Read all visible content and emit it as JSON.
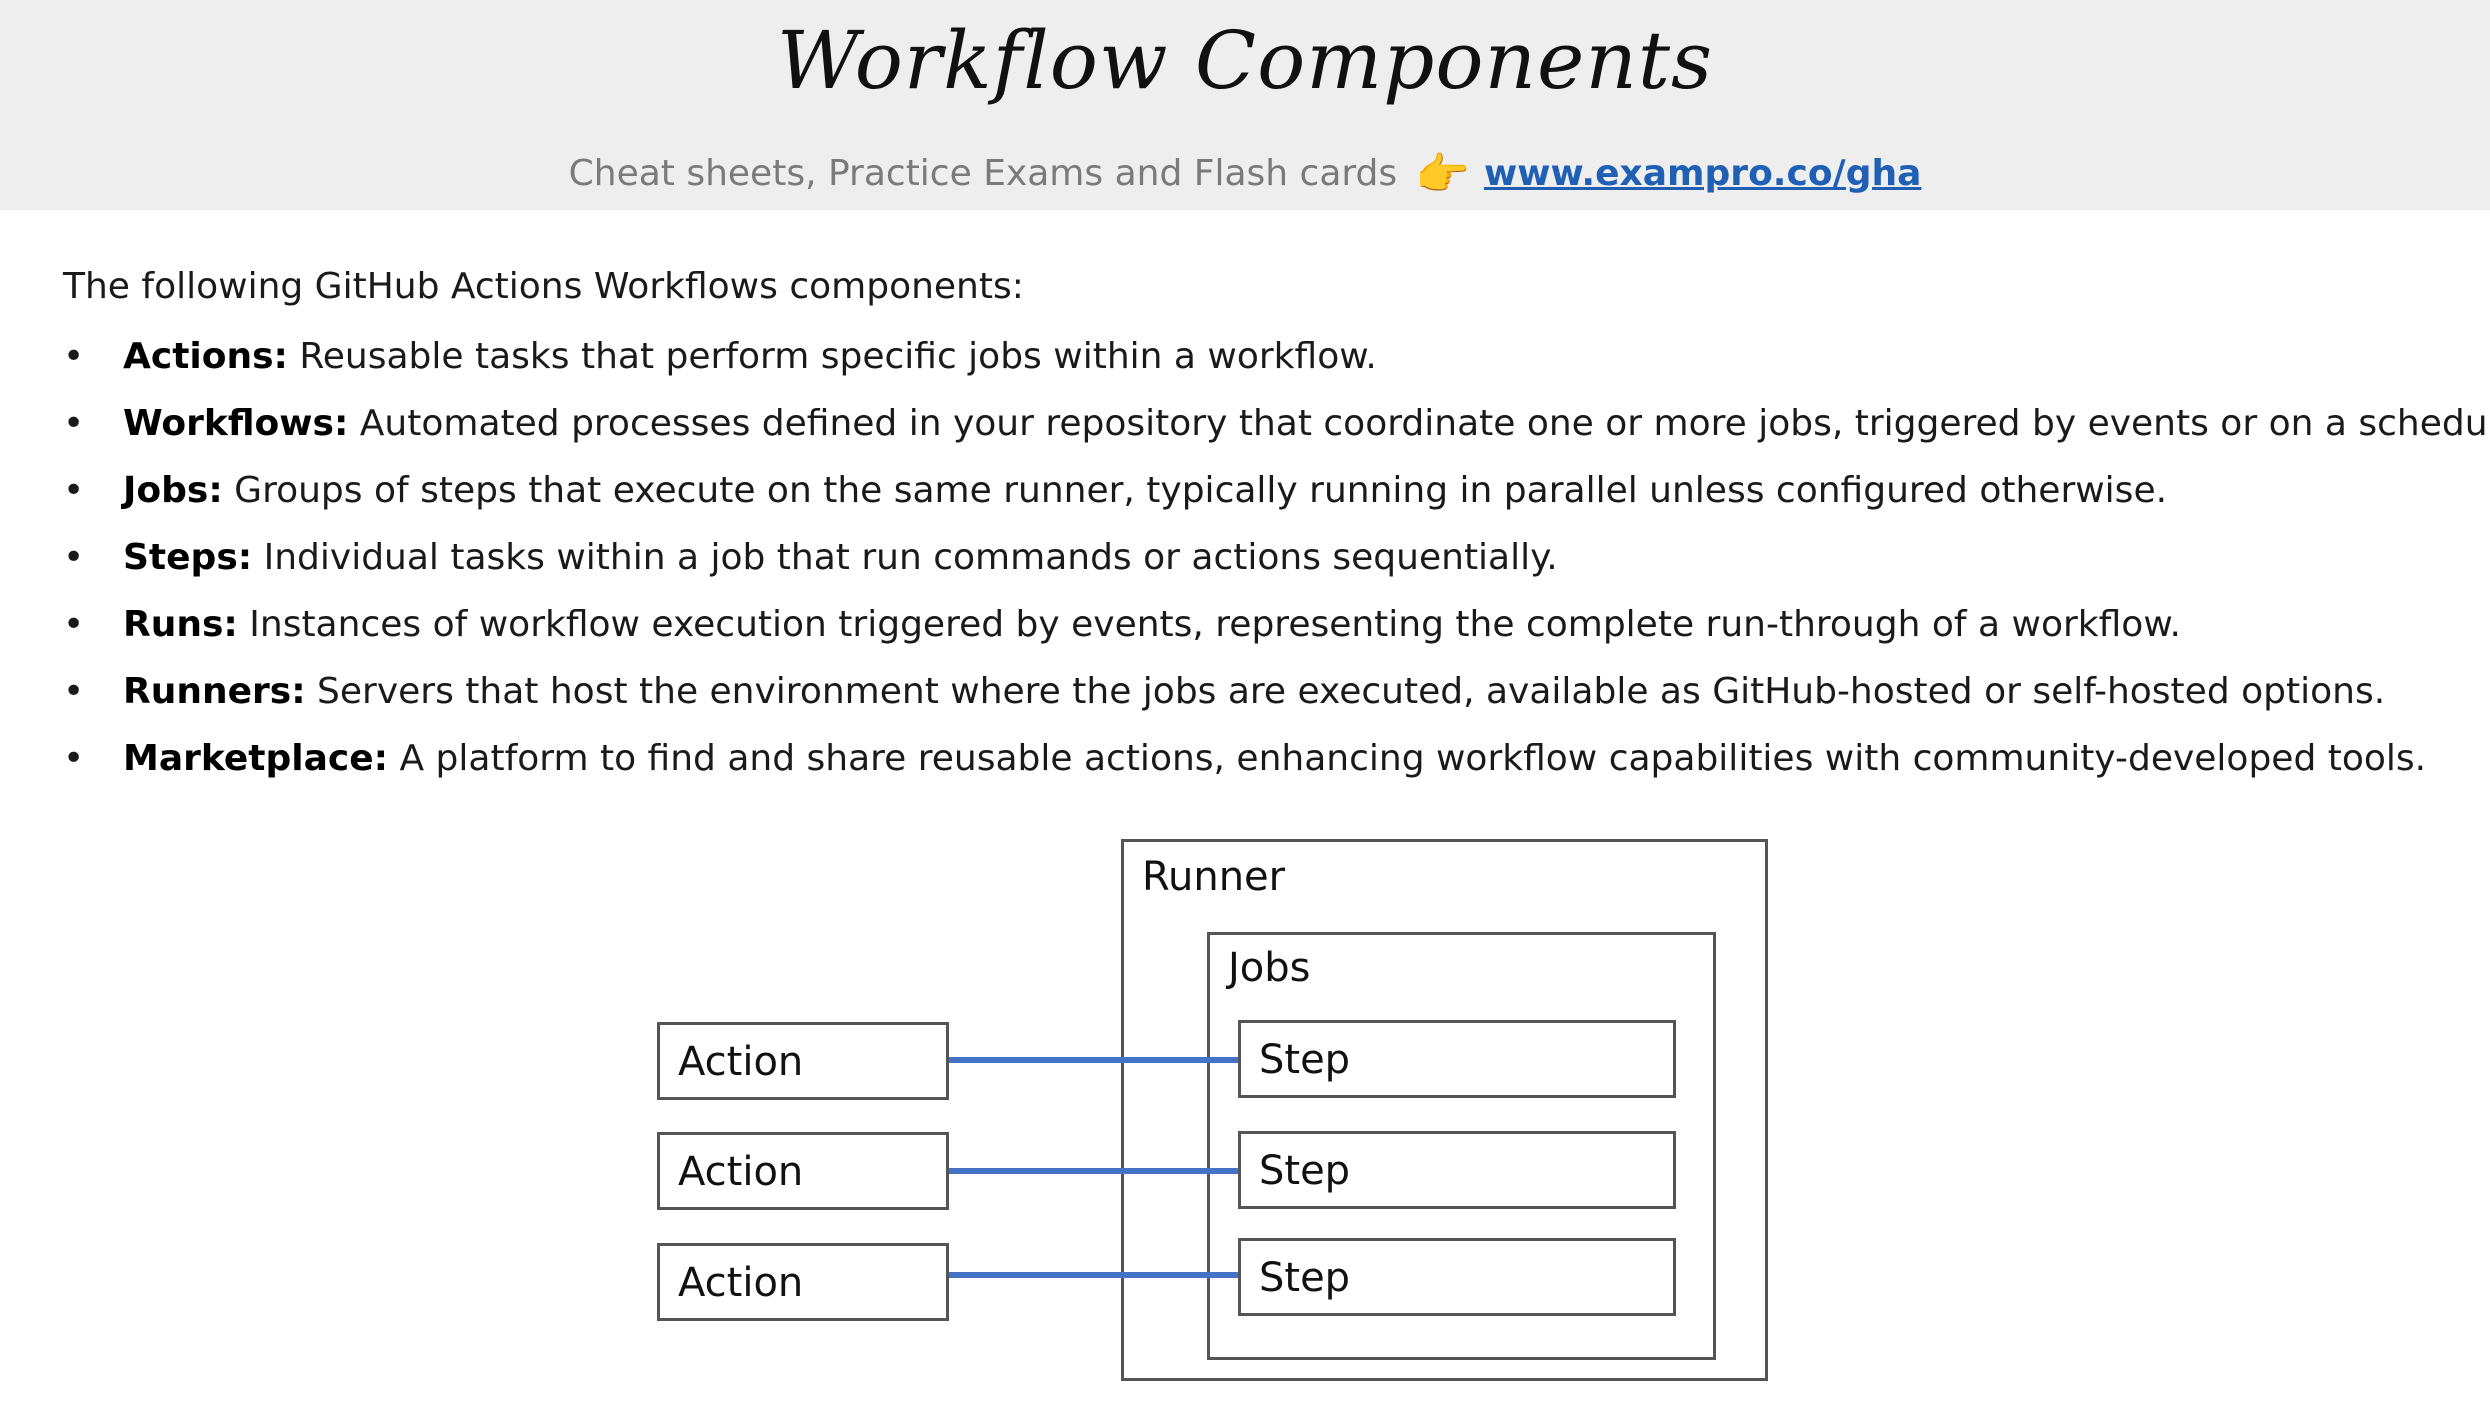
{
  "header": {
    "title": "Workflow Components",
    "subtitle": "Cheat sheets, Practice Exams and Flash cards",
    "pointer_glyph": "👉",
    "link_text": "www.exampro.co/gha"
  },
  "content": {
    "intro": "The following GitHub Actions Workflows components:",
    "items": [
      {
        "term": "Actions:",
        "text": " Reusable tasks that perform specific jobs within a workflow."
      },
      {
        "term": "Workflows:",
        "text": " Automated processes defined in your repository that coordinate one or more jobs, triggered by events or on a schedule."
      },
      {
        "term": "Jobs:",
        "text": " Groups of steps that execute on the same runner, typically running in parallel unless configured otherwise."
      },
      {
        "term": "Steps:",
        "text": " Individual tasks within a job that run commands or actions sequentially."
      },
      {
        "term": "Runs:",
        "text": " Instances of workflow execution triggered by events, representing the complete run-through of a workflow."
      },
      {
        "term": "Runners:",
        "text": " Servers that host the environment where the jobs are executed, available as GitHub-hosted or self-hosted options."
      },
      {
        "term": "Marketplace:",
        "text": " A platform to find and share reusable actions, enhancing workflow capabilities with community-developed tools."
      }
    ]
  },
  "diagram": {
    "runner_label": "Runner",
    "jobs_label": "Jobs",
    "actions": [
      "Action",
      "Action",
      "Action"
    ],
    "steps": [
      "Step",
      "Step",
      "Step"
    ],
    "connector_color": "#4472c4"
  },
  "colors": {
    "header_bg": "#eeeeee",
    "link": "#1f5fb4",
    "subtitle": "#7a7a7a"
  }
}
